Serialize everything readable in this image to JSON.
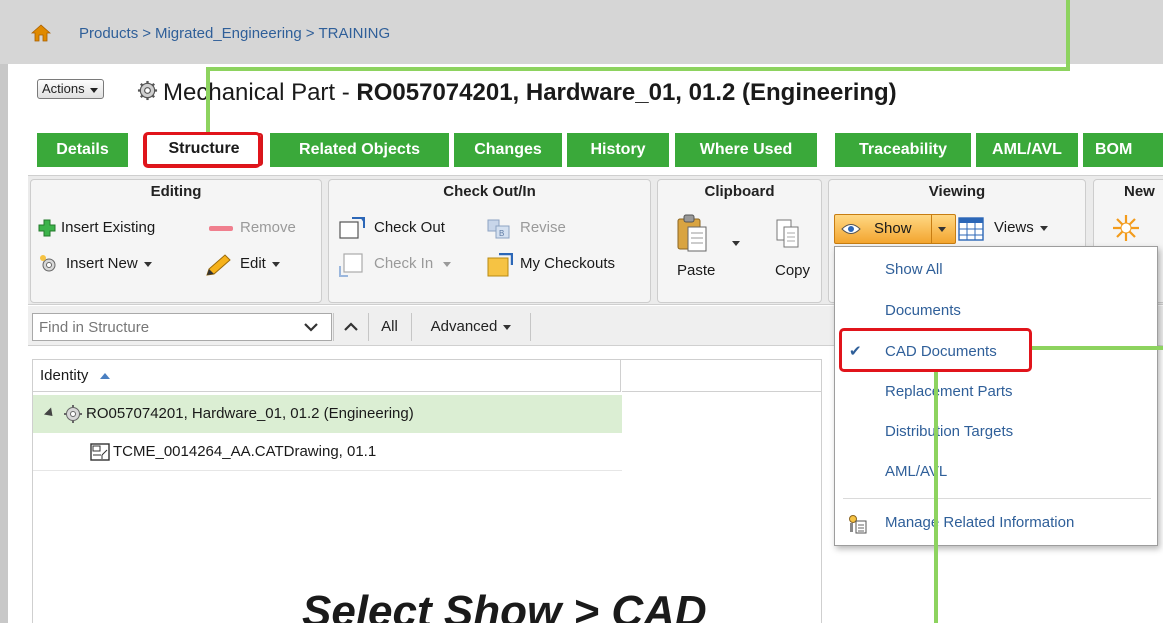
{
  "breadcrumb": {
    "items": [
      "Products",
      "Migrated_Engineering",
      "TRAINING"
    ],
    "separator": ">"
  },
  "header": {
    "actions_label": "Actions",
    "type_label": "Mechanical Part",
    "dash": " - ",
    "object_label": "RO057074201, Hardware_01, 01.2 (Engineering)"
  },
  "tabs": [
    {
      "label": "Details"
    },
    {
      "label": "Structure",
      "active": true
    },
    {
      "label": "Related Objects"
    },
    {
      "label": "Changes"
    },
    {
      "label": "History"
    },
    {
      "label": "Where Used"
    },
    {
      "label": "Traceability"
    },
    {
      "label": "AML/AVL"
    },
    {
      "label": "BOM"
    }
  ],
  "ribbon": {
    "editing": {
      "title": "Editing",
      "insert_existing": "Insert Existing",
      "remove": "Remove",
      "insert_new": "Insert New",
      "edit": "Edit"
    },
    "checkout": {
      "title": "Check Out/In",
      "check_out": "Check Out",
      "revise": "Revise",
      "check_in": "Check In",
      "my_checkouts": "My Checkouts"
    },
    "clipboard": {
      "title": "Clipboard",
      "paste": "Paste",
      "copy": "Copy"
    },
    "viewing": {
      "title": "Viewing",
      "show": "Show",
      "views": "Views"
    },
    "new": {
      "title": "New"
    }
  },
  "findbar": {
    "placeholder": "Find in Structure",
    "all": "All",
    "advanced": "Advanced"
  },
  "grid": {
    "header": "Identity",
    "rows": [
      {
        "label": "RO057074201, Hardware_01, 01.2 (Engineering)"
      },
      {
        "label": "TCME_0014264_AA.CATDrawing, 01.1"
      }
    ]
  },
  "show_menu": {
    "items": [
      {
        "label": "Show All"
      },
      {
        "label": "Documents"
      },
      {
        "label": "CAD Documents",
        "checked": true
      },
      {
        "label": "Replacement Parts"
      },
      {
        "label": "Distribution Targets"
      },
      {
        "label": "AML/AVL"
      },
      {
        "label": "Manage Related Information"
      }
    ]
  },
  "annotation": {
    "text": "Select Show > CAD"
  },
  "colors": {
    "tab_green": "#3aa93a",
    "callout_red": "#e1141b",
    "callout_line_green": "#8dd35f",
    "link_blue": "#2f5f99",
    "show_button_orange": "#f3a52f",
    "selected_row": "#dbeed3"
  }
}
